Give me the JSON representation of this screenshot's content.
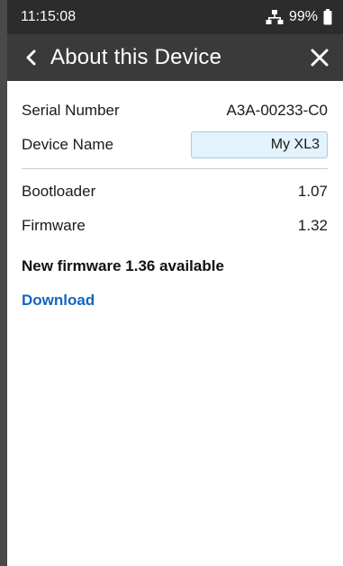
{
  "status_bar": {
    "time": "11:15:08",
    "battery_percent": "99%",
    "network_icon": "network-icon",
    "battery_icon": "battery-icon"
  },
  "header": {
    "title": "About this Device",
    "back_icon": "chevron-left-icon",
    "close_icon": "close-icon"
  },
  "device_info": {
    "serial": {
      "label": "Serial Number",
      "value": "A3A-00233-C0"
    },
    "name": {
      "label": "Device Name",
      "value": "My XL3"
    },
    "bootloader": {
      "label": "Bootloader",
      "value": "1.07"
    },
    "firmware": {
      "label": "Firmware",
      "value": "1.32"
    }
  },
  "update": {
    "notice": "New firmware 1.36 available",
    "download_label": "Download"
  },
  "colors": {
    "status_bar_bg": "#2c2c2c",
    "header_bg": "#3a3a3a",
    "link": "#1565c0",
    "input_bg": "#e3f3fb"
  }
}
